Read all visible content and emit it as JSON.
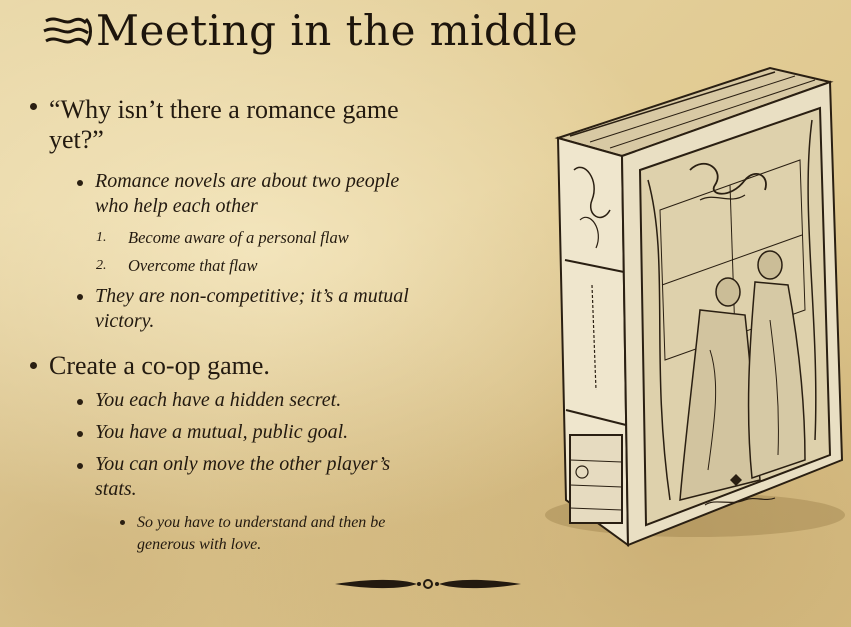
{
  "slide": {
    "title": "Meeting in the middle",
    "bullets": [
      {
        "text": "“Why isn’t there a romance game yet?”",
        "line1": "“Why isn’t there a romance game",
        "line2": "yet?”"
      },
      {
        "line1": "Romance novels are about two people",
        "line2": "who help each other"
      },
      {
        "num": "1.",
        "text": "Become aware of a personal flaw"
      },
      {
        "num": "2.",
        "text": "Overcome that flaw"
      },
      {
        "line1": "They are non-competitive; it’s a mutual",
        "line2": "victory."
      },
      {
        "text": "Create a co-op game."
      },
      {
        "text": "You each have a hidden secret."
      },
      {
        "text": "You have a mutual, public goal."
      },
      {
        "line1": "You can only move the other player’s",
        "line2": "stats."
      },
      {
        "line1": "So you have to understand and then be",
        "line2": "generous with love."
      }
    ]
  },
  "colors": {
    "ink": "#231a10",
    "parchment": "#e6d3a3"
  },
  "icons": [
    "title-flourish-icon",
    "ornamental-divider-icon",
    "game-box-image"
  ]
}
